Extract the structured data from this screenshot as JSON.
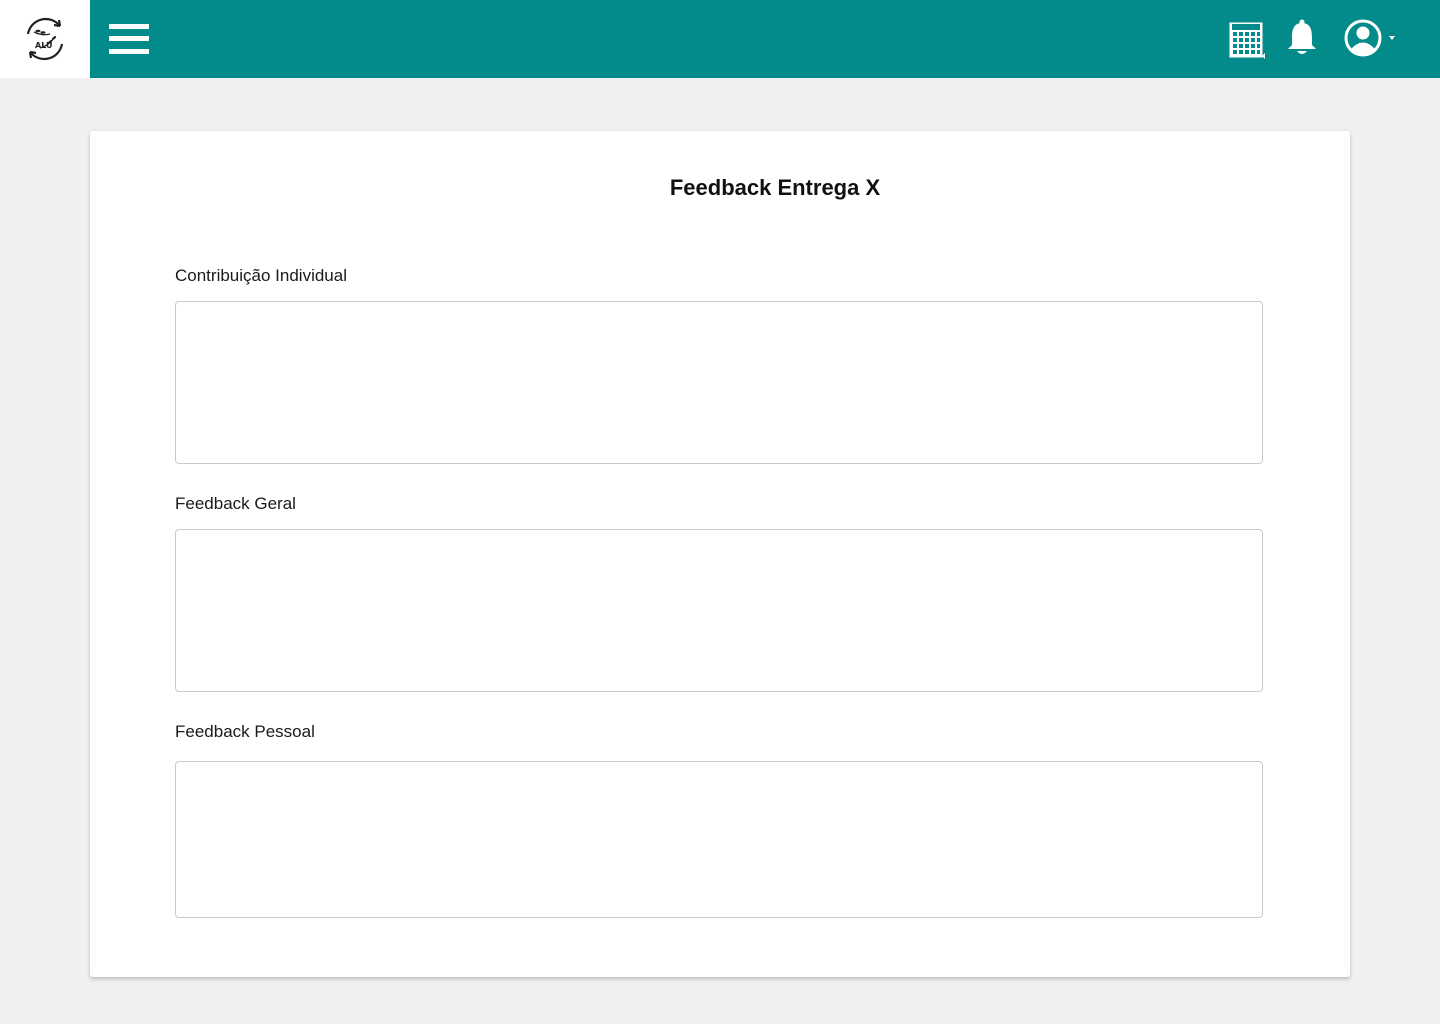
{
  "header": {
    "logo_text": "ALU",
    "menu_icon": "hamburger-menu-icon",
    "calendar_icon": "calendar-icon",
    "bell_icon": "bell-icon",
    "user_icon": "user-avatar-icon",
    "dropdown_icon": "caret-down-icon",
    "bg_color": "#038b8b"
  },
  "card": {
    "title": "Feedback Entrega X",
    "fields": [
      {
        "label": "Contribuição Individual",
        "value": "",
        "placeholder": ""
      },
      {
        "label": "Feedback Geral",
        "value": "",
        "placeholder": ""
      },
      {
        "label": "Feedback Pessoal",
        "value": "",
        "placeholder": ""
      }
    ]
  },
  "colors": {
    "accent": "#038b8b",
    "page_bg": "#f0f0f0",
    "card_bg": "#ffffff"
  }
}
